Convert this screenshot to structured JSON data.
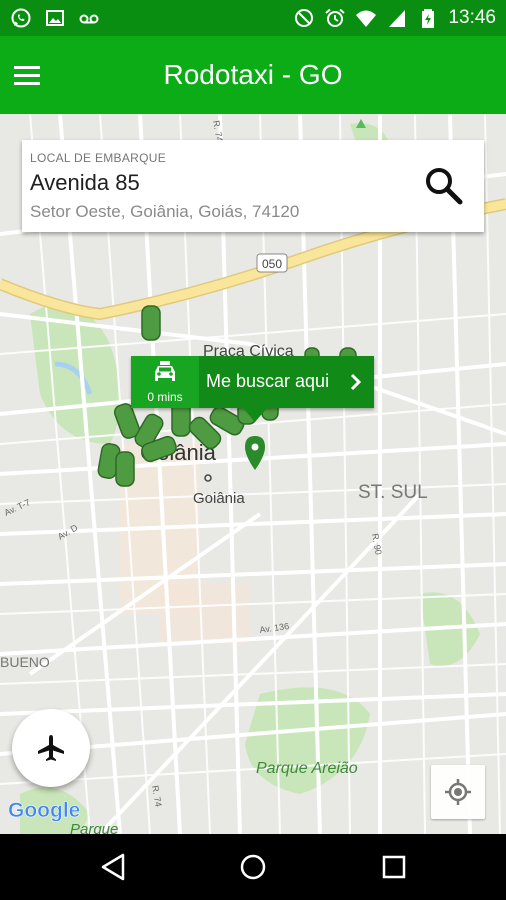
{
  "status_bar": {
    "time": "13:46",
    "left_icons": [
      "whatsapp-icon",
      "image-icon",
      "voicemail-icon"
    ],
    "right_icons": [
      "do-not-disturb-icon",
      "alarm-icon",
      "wifi-icon",
      "signal-icon",
      "battery-icon"
    ]
  },
  "app_bar": {
    "title": "Rodotaxi - GO",
    "menu_icon": "hamburger-menu-icon"
  },
  "pickup": {
    "label": "LOCAL DE EMBARQUE",
    "street": "Avenida 85",
    "address": "Setor Oeste, Goiânia, Goiás, 74120",
    "search_icon": "search-icon"
  },
  "marker": {
    "eta": "0 mins",
    "action": "Me buscar aqui"
  },
  "map_labels": {
    "road_050": "050",
    "praca": "Praça Cívica",
    "goiania_big": "Goiânia",
    "goiania_small": "Goiânia",
    "st_sul": "ST. SUL",
    "bueno": "BUENO",
    "parque_areiao": "Parque Areião",
    "parque": "Parque",
    "av_136": "Av. 136",
    "r_74": "R. 74",
    "r_74b": "R. 74",
    "av_d": "Av. D",
    "av_t7": "Av. T-7",
    "r_90": "R. 90",
    "google": "Google"
  },
  "buttons": {
    "airport_icon": "airplane-icon",
    "locate_icon": "my-location-icon"
  },
  "nav": [
    "back-icon",
    "home-icon",
    "recents-icon"
  ],
  "colors": {
    "status_bar": "#0a8e12",
    "app_bar": "#0cac17",
    "marker": "#128a17",
    "taxi": "#3f9a3a"
  }
}
